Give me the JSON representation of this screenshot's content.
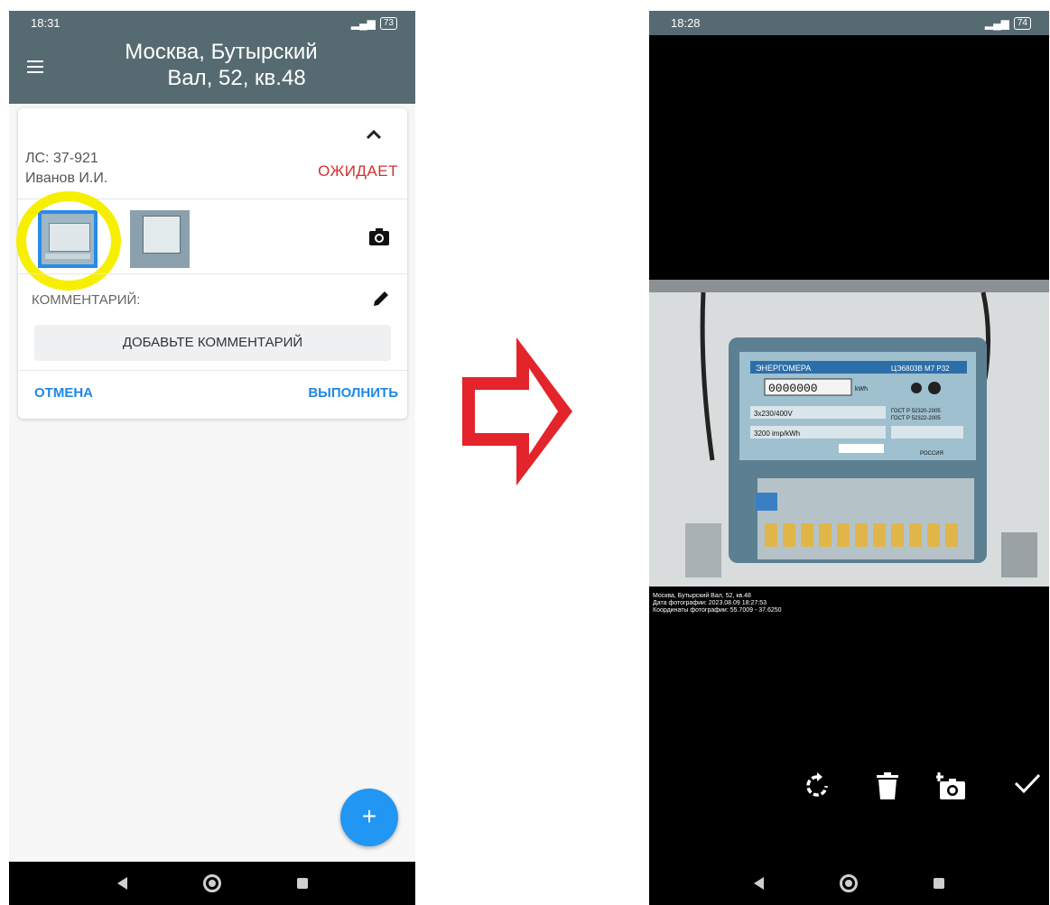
{
  "left_phone": {
    "status_time": "18:31",
    "battery": "73",
    "title_line1": "Москва, Бутырский",
    "title_line2": "Вал,   52, кв.48",
    "account": "ЛС: 37-921",
    "person": "Иванов И.И.",
    "status": "ОЖИДАЕТ",
    "comment_label": "КОММЕНТАРИЙ:",
    "add_comment": "ДОБАВЬТЕ КОММЕНТАРИЙ",
    "cancel": "ОТМЕНА",
    "execute": "ВЫПОЛНИТЬ",
    "fab": "+"
  },
  "right_phone": {
    "status_time": "18:28",
    "battery": "74",
    "meter_brand": "ЭНЕРГОМЕРА",
    "meter_model": "ЦЭ6803В М7 Р32",
    "meter_reading": "0000000",
    "meter_unit": "kWh",
    "meter_spec": "3x230/400V",
    "meter_impulse": "3200 imp/kWh",
    "meter_gost1": "ГОСТ Р 52320-2005",
    "meter_gost2": "ГОСТ Р 52322-2005",
    "meter_country": "РОССИЯ",
    "caption_address": "Москва, Бутырский Вал, 52, кв.48",
    "caption_date": "Дата фотографии: 2023.08.09 18:27:53",
    "caption_coords": "Координаты фотографии: 55.7009 - 37.6250"
  },
  "icons": [
    "menu-icon",
    "chevron-up-icon",
    "camera-icon",
    "pencil-icon",
    "rotate-icon",
    "trash-icon",
    "add-photo-icon",
    "check-icon",
    "arrow-right-icon"
  ],
  "colors": {
    "appbar": "#566b71",
    "accent": "#1e88e5",
    "status_wait": "#d32f2f",
    "highlight": "#f6ef00",
    "arrow": "#e3242b",
    "fab": "#2196f3"
  }
}
